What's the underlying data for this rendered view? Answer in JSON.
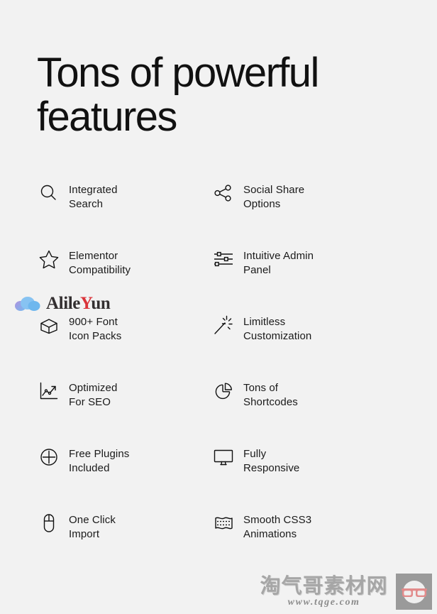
{
  "theme": {
    "background": "#f2f2f2",
    "text_color": "#1a1a1a",
    "heading_color": "#111111",
    "watermark_red": "#d8232a",
    "watermark_gray": "#a6a6a6",
    "glasses_pink": "#e28b8b"
  },
  "heading": {
    "text": "Tons of powerful features"
  },
  "features": {
    "items": [
      {
        "icon": "search-icon",
        "label": "Integrated\nSearch"
      },
      {
        "icon": "share-nodes-icon",
        "label": "Social Share\nOptions"
      },
      {
        "icon": "star-icon",
        "label": "Elementor\nCompatibility"
      },
      {
        "icon": "sliders-icon",
        "label": "Intuitive Admin\nPanel"
      },
      {
        "icon": "box-icon",
        "label": "900+ Font\nIcon Packs"
      },
      {
        "icon": "magic-wand-icon",
        "label": "Limitless\nCustomization"
      },
      {
        "icon": "line-chart-icon",
        "label": "Optimized\nFor SEO"
      },
      {
        "icon": "pie-chart-icon",
        "label": "Tons of\nShortcodes"
      },
      {
        "icon": "plus-circle-icon",
        "label": "Free Plugins\nIncluded"
      },
      {
        "icon": "monitor-icon",
        "label": "Fully\nResponsive"
      },
      {
        "icon": "mouse-icon",
        "label": "One Click\nImport"
      },
      {
        "icon": "animation-wave-icon",
        "label": "Smooth CSS3\nAnimations"
      }
    ]
  },
  "watermarks": {
    "alileyun": {
      "icon": "cloud-icon",
      "text_before": "Alile",
      "text_accent": "Y",
      "text_after": "un"
    },
    "bottom": {
      "chinese": "淘气哥素材网",
      "url": "www.tqge.com",
      "icon": "glasses-face-icon"
    }
  }
}
